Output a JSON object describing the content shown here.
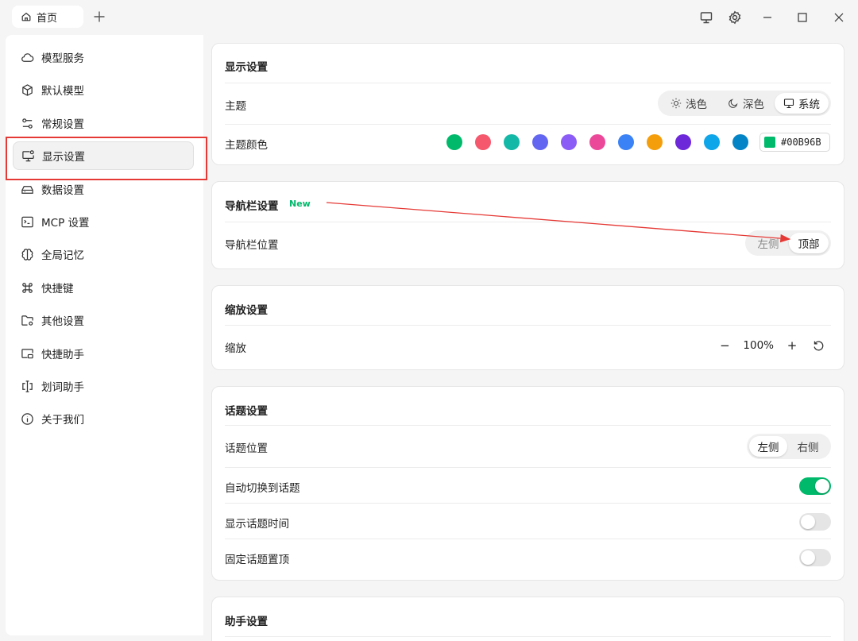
{
  "titlebar": {
    "tab_label": "首页",
    "icons": [
      "home-icon",
      "plus-icon",
      "monitor-icon",
      "gear-icon",
      "minimize-icon",
      "maximize-icon",
      "close-icon"
    ]
  },
  "sidebar": {
    "items": [
      {
        "label": "模型服务",
        "icon": "cloud-icon"
      },
      {
        "label": "默认模型",
        "icon": "cube-icon"
      },
      {
        "label": "常规设置",
        "icon": "sliders-icon"
      },
      {
        "label": "显示设置",
        "icon": "display-settings-icon",
        "active": true
      },
      {
        "label": "数据设置",
        "icon": "drive-icon"
      },
      {
        "label": "MCP 设置",
        "icon": "terminal-icon"
      },
      {
        "label": "全局记忆",
        "icon": "brain-icon"
      },
      {
        "label": "快捷键",
        "icon": "command-icon"
      },
      {
        "label": "其他设置",
        "icon": "folder-gear-icon"
      },
      {
        "label": "快捷助手",
        "icon": "window-icon"
      },
      {
        "label": "划词助手",
        "icon": "text-cursor-icon"
      },
      {
        "label": "关于我们",
        "icon": "info-icon"
      }
    ]
  },
  "display": {
    "title": "显示设置",
    "theme_label": "主题",
    "theme_options": [
      "浅色",
      "深色",
      "系统"
    ],
    "theme_selected": "系统",
    "color_label": "主题颜色",
    "colors": [
      "#00B96B",
      "#F5576C",
      "#14B8A6",
      "#6366F1",
      "#8B5CF6",
      "#EC4899",
      "#3B82F6",
      "#F59E0B",
      "#6D28D9",
      "#0EA5E9",
      "#0284C7"
    ],
    "hex_value": "#00B96B"
  },
  "navbar": {
    "title": "导航栏设置",
    "badge": "New",
    "position_label": "导航栏位置",
    "options": [
      "左侧",
      "顶部"
    ],
    "selected": "顶部"
  },
  "zoom": {
    "title": "缩放设置",
    "label": "缩放",
    "value": "100%",
    "minus": "−",
    "plus": "+"
  },
  "topic": {
    "title": "话题设置",
    "position_label": "话题位置",
    "options": [
      "左侧",
      "右侧"
    ],
    "selected": "左侧",
    "auto_switch_label": "自动切换到话题",
    "auto_switch": true,
    "show_time_label": "显示话题时间",
    "show_time": false,
    "pin_label": "固定话题置顶",
    "pin": false
  },
  "assistant": {
    "title": "助手设置"
  },
  "colors": {
    "accent": "#00B96B",
    "annotation": "#E53935"
  }
}
